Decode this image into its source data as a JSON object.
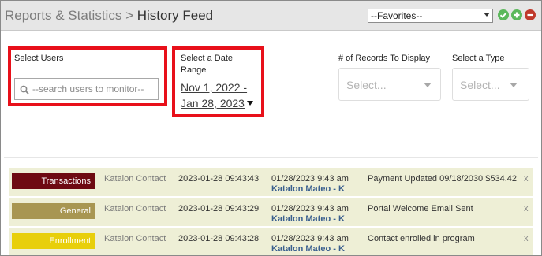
{
  "header": {
    "breadcrumb_parent": "Reports & Statistics",
    "separator": ">",
    "page_title": "History Feed",
    "favorites_value": "--Favorites--"
  },
  "icons": {
    "check": {
      "name": "check-circle-icon",
      "color": "#5cb85c"
    },
    "add": {
      "name": "plus-circle-icon",
      "color": "#5cb85c"
    },
    "remove": {
      "name": "minus-circle-icon",
      "color": "#c0392b"
    }
  },
  "filters": {
    "users": {
      "label": "Select Users",
      "placeholder": "--search users to monitor--"
    },
    "date": {
      "label_line1": "Select a Date",
      "label_line2": "Range",
      "range_line1": "Nov 1, 2022 -",
      "range_line2": "Jan 28, 2023"
    },
    "records": {
      "label": "# of Records To Display",
      "placeholder": "Select..."
    },
    "type": {
      "label": "Select a Type",
      "placeholder": "Select..."
    }
  },
  "highlight_color": "#e8101a",
  "feed": {
    "rows": [
      {
        "type": "Transactions",
        "color": "#6e0a12",
        "user": "Katalon Contact",
        "timestamp": "2023-01-28 09:43:43",
        "date_time": "01/28/2023 9:43 am",
        "actor": "Katalon Mateo - K",
        "description": "Payment Updated 09/18/2030 $534.42",
        "close": "x"
      },
      {
        "type": "General",
        "color": "#a89652",
        "user": "Katalon Contact",
        "timestamp": "2023-01-28 09:43:29",
        "date_time": "01/28/2023 9:43 am",
        "actor": "Katalon Mateo - K",
        "description": "Portal Welcome Email Sent",
        "close": "x"
      },
      {
        "type": "Enrollment",
        "color": "#e8cf0b",
        "user": "Katalon Contact",
        "timestamp": "2023-01-28 09:43:28",
        "date_time": "01/28/2023 9:43 am",
        "actor": "Katalon Mateo - K",
        "description": "Contact enrolled in program",
        "close": "x"
      }
    ]
  }
}
